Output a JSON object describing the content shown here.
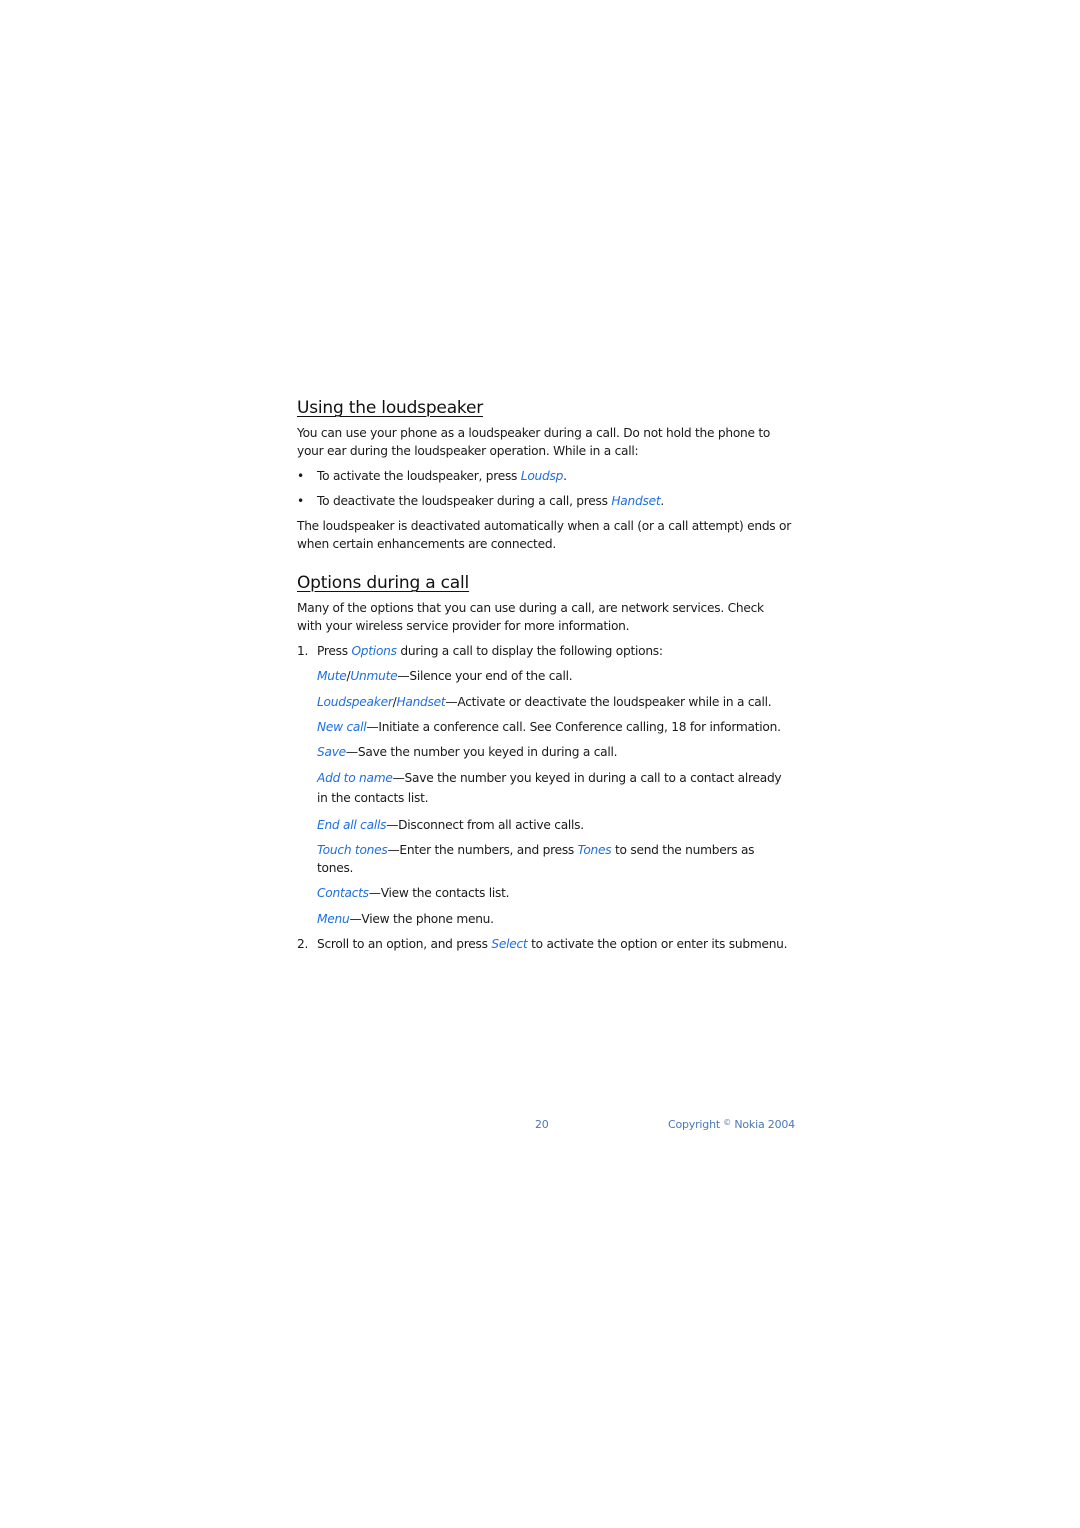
{
  "colors": {
    "link": "#1f6fe0",
    "text": "#1a1a1a",
    "footer": "#4a78b8"
  },
  "section1": {
    "title": "Using the loudspeaker",
    "intro": "You can use your phone as a loudspeaker during a call. Do not hold the phone to your ear during the loudspeaker operation. While in a call:",
    "bullets": [
      {
        "mark": "•",
        "before": "To activate the loudspeaker, press ",
        "link": "Loudsp",
        "after": "."
      },
      {
        "mark": "•",
        "before": "To deactivate the loudspeaker during a call, press ",
        "link": "Handset",
        "after": "."
      }
    ],
    "outro": "The loudspeaker is deactivated automatically when a call (or a call attempt) ends or when certain enhancements are connected."
  },
  "section2": {
    "title": "Options during a call",
    "intro": "Many of the options that you can use during a call, are network services. Check with your wireless service provider for more information.",
    "step1": {
      "num": "1.",
      "before": "Press ",
      "link": "Options",
      "after": " during a call to display the following options:"
    },
    "options": [
      {
        "link": "Mute",
        "sep": "/",
        "link2": "Unmute",
        "desc": "—Silence your end of the call."
      },
      {
        "link": "Loudspeaker",
        "sep": "/",
        "link2": "Handset",
        "desc": "—Activate or deactivate the loudspeaker while in a call."
      },
      {
        "link": "New call",
        "desc": "—Initiate a conference call. See Conference calling, 18 for information."
      },
      {
        "link": "Save",
        "desc": "—Save the number you keyed in during a call."
      },
      {
        "link": "Add to name",
        "desc": "—Save the number you keyed in during a call to a contact already in the contacts list."
      },
      {
        "link": "End all calls",
        "desc": "—Disconnect from all active calls."
      },
      {
        "link": "Touch tones",
        "desc": "—Enter the numbers, and press ",
        "link2": "Tones",
        "desc2": " to send the numbers as tones."
      },
      {
        "link": "Contacts",
        "desc": "—View the contacts list."
      },
      {
        "link": "Menu",
        "desc": "—View the phone menu."
      }
    ],
    "step2": {
      "num": "2.",
      "before": "Scroll to an option, and press ",
      "link": "Select",
      "after": " to activate the option or enter its submenu."
    }
  },
  "footer": {
    "page_number": "20",
    "copyright_label": "Copyright",
    "copyright_symbol": "©",
    "copyright_owner": "Nokia 2004"
  }
}
